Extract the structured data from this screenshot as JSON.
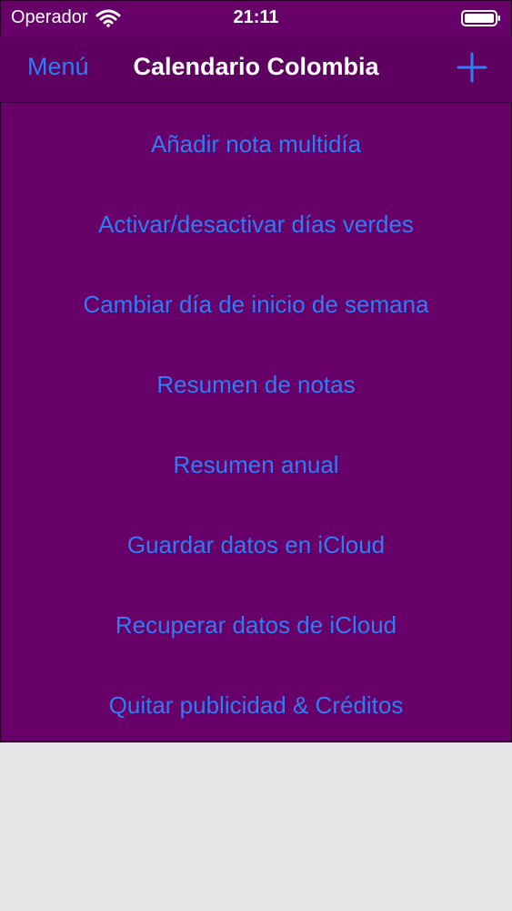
{
  "status_bar": {
    "carrier": "Operador",
    "time": "21:11",
    "wifi_icon": "wifi-icon",
    "battery_icon": "battery-icon"
  },
  "nav": {
    "menu_label": "Menú",
    "title": "Calendario Colombia",
    "add_icon": "plus-icon"
  },
  "menu": {
    "items": [
      {
        "label": "Añadir nota multidía"
      },
      {
        "label": "Activar/desactivar días verdes"
      },
      {
        "label": "Cambiar día de inicio de semana"
      },
      {
        "label": "Resumen de notas"
      },
      {
        "label": "Resumen anual"
      },
      {
        "label": "Guardar datos en iCloud"
      },
      {
        "label": "Recuperar datos de iCloud"
      },
      {
        "label": "Quitar publicidad & Créditos"
      }
    ]
  },
  "colors": {
    "background_purple": "#670068",
    "nav_purple": "#5d005f",
    "link_blue": "#2f7cf5",
    "lower_area_gray": "#e6e6e9"
  }
}
